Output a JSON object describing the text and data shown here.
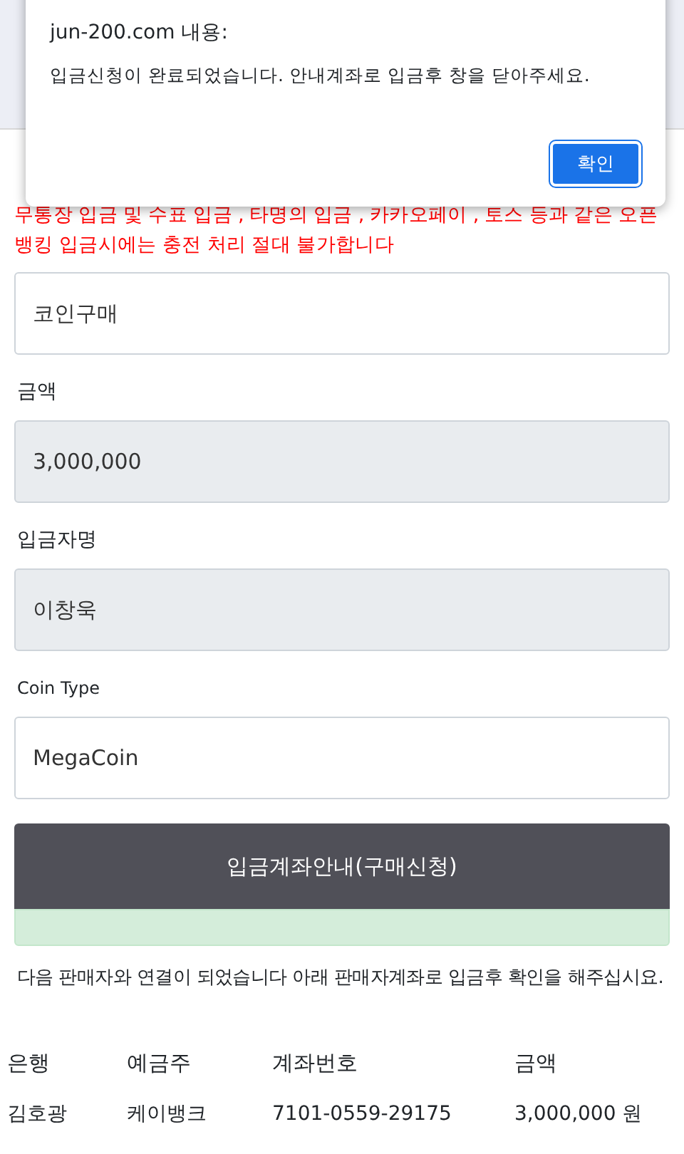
{
  "dialog": {
    "title": "jun-200.com 내용:",
    "message": "입금신청이 완료되었습니다. 안내계좌로 입금후 창을 닫아주세요.",
    "button": "확인"
  },
  "warning": "무통장 입금 및 수표 입금 , 타명의 입금 , 카카오페이 , 토스 등과 같은 오픈뱅킹 입금시에는 충전 처리 절대 불가합니다",
  "fields": [
    {
      "value": "코인구매",
      "disabled": false
    },
    {
      "label": "금액",
      "value": "3,000,000",
      "disabled": true
    },
    {
      "label": "입금자명",
      "value": "이창욱",
      "disabled": true
    },
    {
      "label": "Coin Type",
      "value": "MegaCoin",
      "disabled": false
    }
  ],
  "submit_button": "입금계좌안내(구매신청)",
  "notice": "다음 판매자와 연결이 되었습니다 아래 판매자계좌로 입금후 확인을 해주십시요.",
  "table": {
    "columns": [
      "은행",
      "예금주",
      "계좌번호",
      "금액"
    ],
    "rows": [
      [
        "김호광",
        "케이뱅크",
        "7101-0559-29175",
        "3,000,000 원"
      ]
    ]
  }
}
